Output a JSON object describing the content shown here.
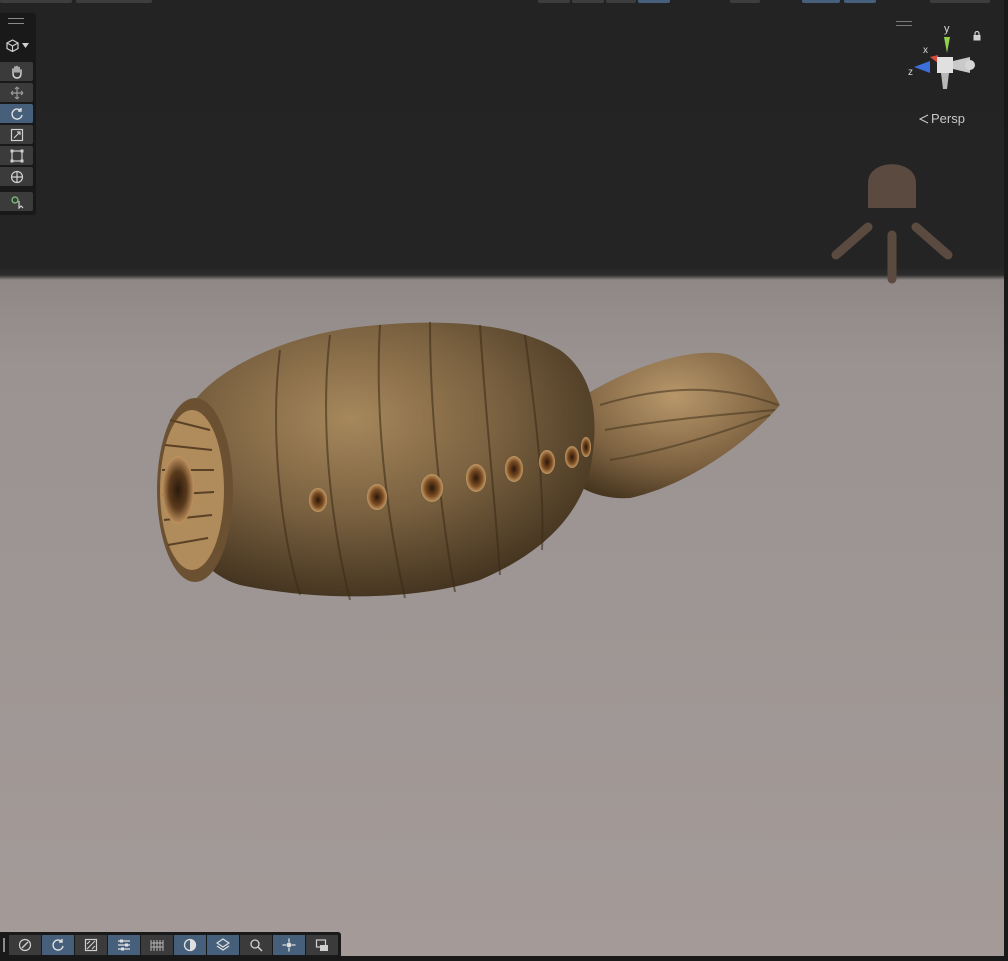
{
  "viewport": {
    "projection_label": "Persp",
    "gizmo": {
      "axis_y": "y",
      "axis_x": "x",
      "axis_z": "z"
    },
    "colors": {
      "sky": "#232323",
      "ground": "#9e9694",
      "active_tool": "#46607c",
      "tool_bg": "#3b3b3b",
      "overlay_bg": "#191919",
      "light_icon": "#5a4a40",
      "axis_y": "#8fd14f",
      "axis_x": "#d94a3c",
      "axis_z": "#3c6fd9"
    }
  },
  "tools_overlay": {
    "view_mode_icon": "cube-icon",
    "items": [
      {
        "name": "view-tool",
        "icon": "hand-icon",
        "active": false
      },
      {
        "name": "move-tool",
        "icon": "move-arrows-icon",
        "active": false
      },
      {
        "name": "rotate-tool",
        "icon": "rotate-icon",
        "active": true
      },
      {
        "name": "scale-tool",
        "icon": "scale-icon",
        "active": false
      },
      {
        "name": "rect-tool",
        "icon": "rect-transform-icon",
        "active": false
      },
      {
        "name": "transform-tool",
        "icon": "transform-icon",
        "active": false
      },
      {
        "name": "custom-tool",
        "icon": "custom-tool-icon",
        "active": false
      }
    ]
  },
  "bottom_toolbar": {
    "items": [
      {
        "name": "draw-mode",
        "icon": "compass-icon",
        "active": false
      },
      {
        "name": "toggle-2d",
        "icon": "rotate-icon",
        "active": true
      },
      {
        "name": "lighting",
        "icon": "lighting-icon",
        "active": false
      },
      {
        "name": "audio-effects",
        "icon": "sliders-icon",
        "active": true
      },
      {
        "name": "fx",
        "icon": "fx-icon",
        "active": false
      },
      {
        "name": "scene-visibility",
        "icon": "sphere-icon",
        "active": true
      },
      {
        "name": "grid",
        "icon": "grid-icon",
        "active": true
      },
      {
        "name": "search",
        "icon": "search-icon",
        "active": false
      },
      {
        "name": "gizmos",
        "icon": "gizmo-icon",
        "active": true
      },
      {
        "name": "camera",
        "icon": "camera-icon",
        "active": false
      }
    ]
  }
}
